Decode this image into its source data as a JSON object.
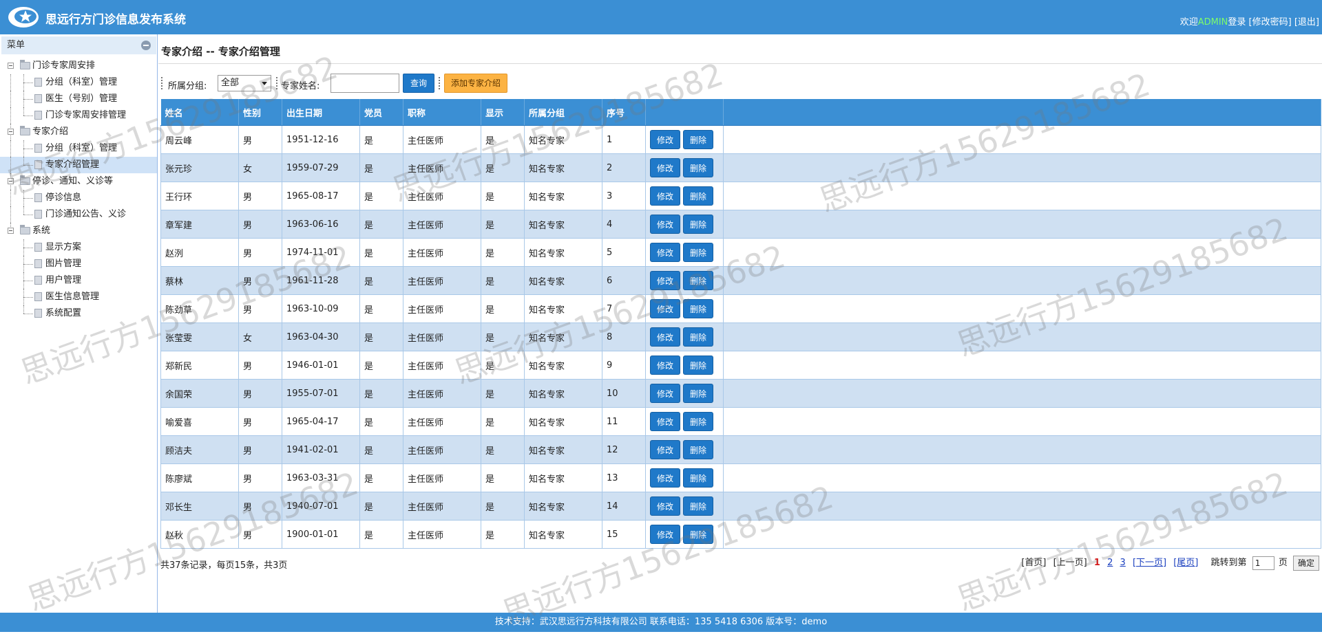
{
  "header": {
    "title": "思远行方门诊信息发布系统",
    "welcome_prefix": "欢迎",
    "username": "ADMIN",
    "login_suffix": "登录",
    "change_password": "[修改密码]",
    "logout": "[退出]"
  },
  "sidebar": {
    "menu_title": "菜单",
    "groups": [
      {
        "label": "门诊专家周安排",
        "items": [
          "分组（科室）管理",
          "医生（号别）管理",
          "门诊专家周安排管理"
        ]
      },
      {
        "label": "专家介绍",
        "items": [
          "分组（科室）管理",
          "专家介绍管理"
        ]
      },
      {
        "label": "停诊、通知、义诊等",
        "items": [
          "停诊信息",
          "门诊通知公告、义诊"
        ]
      },
      {
        "label": "系统",
        "items": [
          "显示方案",
          "图片管理",
          "用户管理",
          "医生信息管理",
          "系统配置"
        ]
      }
    ],
    "selected": "专家介绍管理"
  },
  "main": {
    "page_title": "专家介绍 -- 专家介绍管理",
    "toolbar": {
      "group_label": "所属分组:",
      "group_value": "全部",
      "name_label": "专家姓名:",
      "name_value": "",
      "query_button": "查询",
      "add_button": "添加专家介绍"
    },
    "table": {
      "columns": [
        "姓名",
        "性别",
        "出生日期",
        "党员",
        "职称",
        "显示",
        "所属分组",
        "序号",
        "",
        ""
      ],
      "edit_label": "修改",
      "delete_label": "删除",
      "rows": [
        [
          "周云峰",
          "男",
          "1951-12-16",
          "是",
          "主任医师",
          "是",
          "知名专家",
          "1"
        ],
        [
          "张元珍",
          "女",
          "1959-07-29",
          "是",
          "主任医师",
          "是",
          "知名专家",
          "2"
        ],
        [
          "王行环",
          "男",
          "1965-08-17",
          "是",
          "主任医师",
          "是",
          "知名专家",
          "3"
        ],
        [
          "章军建",
          "男",
          "1963-06-16",
          "是",
          "主任医师",
          "是",
          "知名专家",
          "4"
        ],
        [
          "赵洌",
          "男",
          "1974-11-01",
          "是",
          "主任医师",
          "是",
          "知名专家",
          "5"
        ],
        [
          "蔡林",
          "男",
          "1961-11-28",
          "是",
          "主任医师",
          "是",
          "知名专家",
          "6"
        ],
        [
          "陈劲草",
          "男",
          "1963-10-09",
          "是",
          "主任医师",
          "是",
          "知名专家",
          "7"
        ],
        [
          "张莹雯",
          "女",
          "1963-04-30",
          "是",
          "主任医师",
          "是",
          "知名专家",
          "8"
        ],
        [
          "郑新民",
          "男",
          "1946-01-01",
          "是",
          "主任医师",
          "是",
          "知名专家",
          "9"
        ],
        [
          "余国荣",
          "男",
          "1955-07-01",
          "是",
          "主任医师",
          "是",
          "知名专家",
          "10"
        ],
        [
          "喻爱喜",
          "男",
          "1965-04-17",
          "是",
          "主任医师",
          "是",
          "知名专家",
          "11"
        ],
        [
          "顾洁夫",
          "男",
          "1941-02-01",
          "是",
          "主任医师",
          "是",
          "知名专家",
          "12"
        ],
        [
          "陈廖斌",
          "男",
          "1963-03-31",
          "是",
          "主任医师",
          "是",
          "知名专家",
          "13"
        ],
        [
          "邓长生",
          "男",
          "1940-07-01",
          "是",
          "主任医师",
          "是",
          "知名专家",
          "14"
        ],
        [
          "赵秋",
          "男",
          "1900-01-01",
          "是",
          "主任医师",
          "是",
          "知名专家",
          "15"
        ]
      ]
    },
    "summary": "共37条记录，每页15条，共3页",
    "pager": {
      "first": "[首页]",
      "prev": "[上一页]",
      "pages": [
        "1",
        "2",
        "3"
      ],
      "current_page": "1",
      "next": "[下一页]",
      "last": "[尾页]",
      "jump_prefix": "跳转到第",
      "jump_value": "1",
      "jump_suffix": "页",
      "confirm": "确定"
    }
  },
  "footer": {
    "text": "技术支持：武汉思远行方科技有限公司  联系电话：135 5418 6306  版本号：demo"
  },
  "watermark": "思远行方15629185682",
  "colors": {
    "header_blue": "#3b8fd4",
    "button_blue": "#1f79c9",
    "add_button_orange": "#fcb343",
    "row_alt": "#cfe0f2",
    "username_green": "#7cfc6b",
    "current_page_red": "#d41c1c"
  }
}
